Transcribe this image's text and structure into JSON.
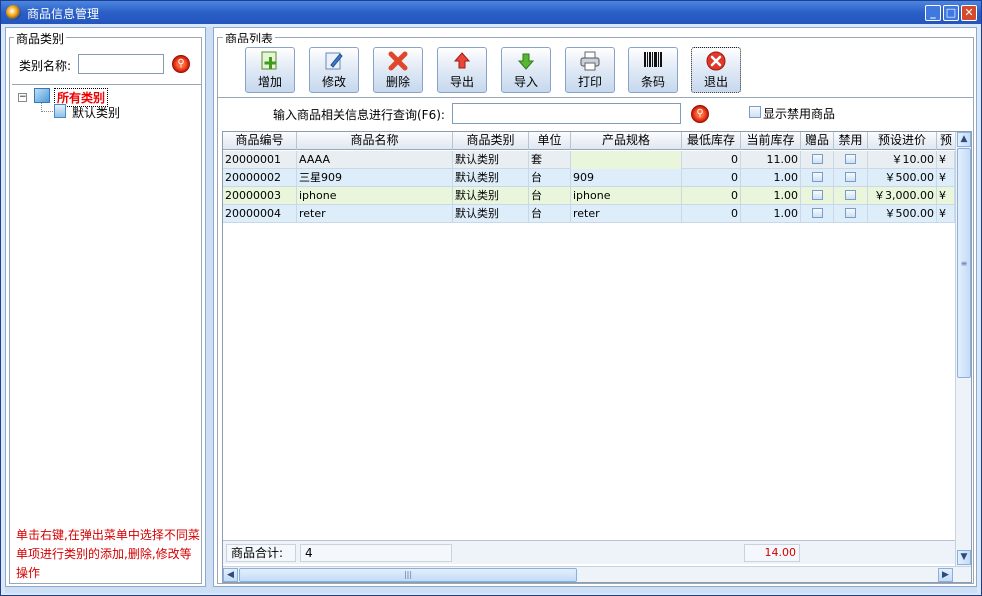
{
  "window": {
    "title": "商品信息管理"
  },
  "left": {
    "group_title": "商品类别",
    "category_label": "类别名称:",
    "category_input_value": "",
    "tree": {
      "root": "所有类别",
      "children": [
        "默认类别"
      ]
    },
    "hint": "单击右键,在弹出菜单中选择不同菜单项进行类别的添加,删除,修改等操作"
  },
  "right": {
    "group_title": "商品列表",
    "toolbar": [
      {
        "label": "增加",
        "icon": "add-icon"
      },
      {
        "label": "修改",
        "icon": "edit-icon"
      },
      {
        "label": "删除",
        "icon": "delete-icon"
      },
      {
        "label": "导出",
        "icon": "export-icon"
      },
      {
        "label": "导入",
        "icon": "import-icon"
      },
      {
        "label": "打印",
        "icon": "print-icon"
      },
      {
        "label": "条码",
        "icon": "barcode-icon"
      },
      {
        "label": "退出",
        "icon": "exit-icon"
      }
    ],
    "query_label": "输入商品相关信息进行查询(F6):",
    "query_value": "",
    "show_disabled_label": "显示禁用商品",
    "show_disabled_checked": false
  },
  "table": {
    "columns": [
      "商品编号",
      "商品名称",
      "商品类别",
      "单位",
      "产品规格",
      "最低库存",
      "当前库存",
      "赠品",
      "禁用",
      "预设进价",
      "预"
    ],
    "rows": [
      {
        "code": "20000001",
        "name": "AAAA",
        "category": "默认类别",
        "unit": "套",
        "spec": "",
        "min_stock": "0",
        "cur_stock": "11.00",
        "gift": false,
        "disabled": false,
        "price": "￥10.00",
        "next": "¥"
      },
      {
        "code": "20000002",
        "name": "三星909",
        "category": "默认类别",
        "unit": "台",
        "spec": "909",
        "min_stock": "0",
        "cur_stock": "1.00",
        "gift": false,
        "disabled": false,
        "price": "￥500.00",
        "next": "¥"
      },
      {
        "code": "20000003",
        "name": "iphone",
        "category": "默认类别",
        "unit": "台",
        "spec": "iphone",
        "min_stock": "0",
        "cur_stock": "1.00",
        "gift": false,
        "disabled": false,
        "price": "￥3,000.00",
        "next": "¥"
      },
      {
        "code": "20000004",
        "name": "reter",
        "category": "默认类别",
        "unit": "台",
        "spec": "reter",
        "min_stock": "0",
        "cur_stock": "1.00",
        "gift": false,
        "disabled": false,
        "price": "￥500.00",
        "next": "¥"
      }
    ],
    "row_colors": [
      "#e9eef3",
      "#ddedf9",
      "#eaf6dc",
      "#ddedf9"
    ],
    "footer": {
      "label": "商品合计:",
      "count": "4",
      "stock_total": "14.00"
    }
  }
}
